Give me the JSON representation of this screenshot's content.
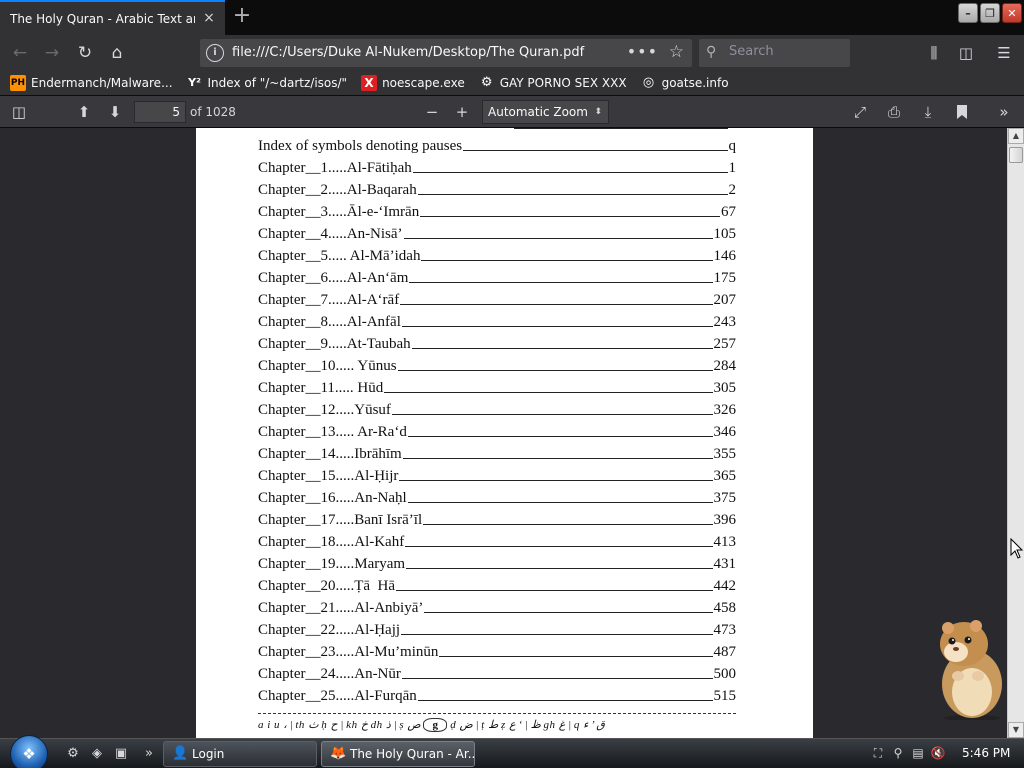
{
  "tab": {
    "title": "The Holy Quran - Arabic Text and E",
    "close_icon": "×",
    "new_tab": "+"
  },
  "window_buttons": {
    "minimize": "–",
    "maximize": "❐",
    "close": "✕"
  },
  "navbar": {
    "back": "←",
    "forward": "→",
    "reload": "↻",
    "home": "⌂",
    "url": "file:///C:/Users/Duke Al-Nukem/Desktop/The Quran.pdf",
    "page_actions": "•••",
    "bookmark_star": "☆",
    "search_placeholder": "Search",
    "library": "⫼",
    "sidebar": "◫",
    "menu": "☰"
  },
  "bookmarks": [
    {
      "icon": "PH",
      "label": "Endermanch/Malware..."
    },
    {
      "icon": "Y²",
      "label": "Index of \"/~dartz/isos/\""
    },
    {
      "icon": "X",
      "label": "noescape.exe"
    },
    {
      "icon": "⚙",
      "label": "GAY PORNO SEX XXX"
    },
    {
      "icon": "◎",
      "label": "goatse.info"
    }
  ],
  "pdf_toolbar": {
    "sidebar_toggle": "◫",
    "prev_page": "⬆",
    "next_page": "⬇",
    "page_number": "5",
    "page_count": "of 1028",
    "zoom_out": "−",
    "zoom_in": "+",
    "zoom_value": "Automatic Zoom",
    "zoom_arrow": "⬍",
    "presentation": "⤢",
    "print": "⎙",
    "save": "⤓",
    "bookmark": "🔖",
    "tools": "»"
  },
  "toc": {
    "header_line": {
      "label": "Index of symbols denoting pauses",
      "page": "q"
    },
    "entries": [
      {
        "label": "Chapter__1.....Al-Fātiḥah",
        "page": "1"
      },
      {
        "label": "Chapter__2.....Al-Baqarah",
        "page": "2"
      },
      {
        "label": "Chapter__3.....Āl-e-‘Imrān",
        "page": "67"
      },
      {
        "label": "Chapter__4.....An-Nisā’",
        "page": "105"
      },
      {
        "label": "Chapter__5..... Al-Mā’idah",
        "page": "146"
      },
      {
        "label": "Chapter__6.....Al-An‘ām",
        "page": "175"
      },
      {
        "label": "Chapter__7.....Al-A‘rāf",
        "page": "207"
      },
      {
        "label": "Chapter__8.....Al-Anfāl",
        "page": "243"
      },
      {
        "label": "Chapter__9.....At-Taubah",
        "page": "257"
      },
      {
        "label": "Chapter__10..... Yūnus",
        "page": "284"
      },
      {
        "label": "Chapter__11..... Hūd",
        "page": "305"
      },
      {
        "label": "Chapter__12.....Yūsuf",
        "page": "326"
      },
      {
        "label": "Chapter__13..... Ar-Ra‘d",
        "page": "346"
      },
      {
        "label": "Chapter__14.....Ibrāhīm",
        "page": "355"
      },
      {
        "label": "Chapter__15.....Al-Ḥijr",
        "page": "365"
      },
      {
        "label": "Chapter__16.....An-Naḥl",
        "page": "375"
      },
      {
        "label": "Chapter__17.....Banī Isrā’īl",
        "page": "396"
      },
      {
        "label": "Chapter__18.....Al-Kahf",
        "page": "413"
      },
      {
        "label": "Chapter__19.....Maryam",
        "page": "431"
      },
      {
        "label": "Chapter__20.....Ṭā  Hā",
        "page": "442"
      },
      {
        "label": "Chapter__21.....Al-Anbiyā’",
        "page": "458"
      },
      {
        "label": "Chapter__22.....Al-Ḥajj",
        "page": "473"
      },
      {
        "label": "Chapter__23.....Al-Mu’minūn",
        "page": "487"
      },
      {
        "label": "Chapter__24.....An-Nūr",
        "page": "500"
      },
      {
        "label": "Chapter__25.....Al-Furqān",
        "page": "515"
      }
    ],
    "translit_left": "a i u ، | th ث  ḥ ح | kh خ  dh ذ | ṣ ص ",
    "translit_bubble": "g",
    "translit_right": " ḍ ض | ṭ ط  ẓ ظ | ‘ ع  gh غ | q ق  ’ ء"
  },
  "scrollbar": {
    "up": "▲",
    "down": "▼"
  },
  "taskbar": {
    "start_icon": "❖",
    "quick_launch": [
      "⚙",
      "◈",
      "▣"
    ],
    "overflow": "»",
    "items": [
      {
        "icon": "👤",
        "label": "Login",
        "active": false
      },
      {
        "icon": "🦊",
        "label": "The Holy Quran - Ar...",
        "active": true
      }
    ],
    "tray_icons": [
      "⛶",
      "⚲",
      "▤",
      "🔇"
    ],
    "clock": "5:46 PM"
  }
}
